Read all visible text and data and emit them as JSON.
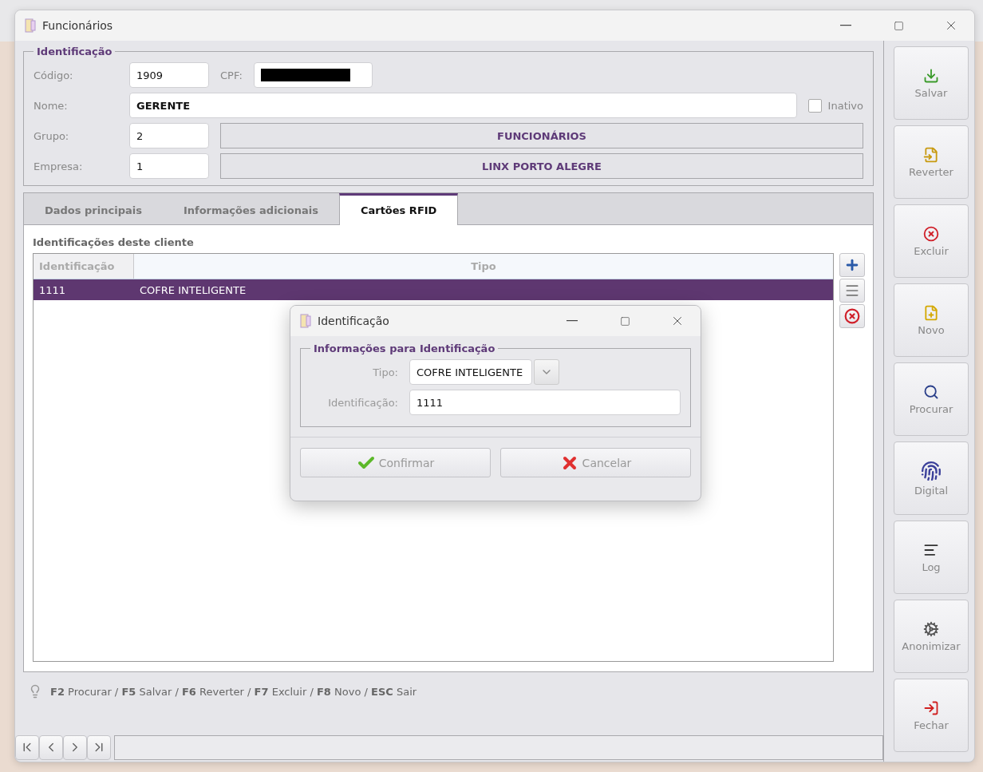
{
  "window": {
    "title": "Funcionários"
  },
  "identificacao": {
    "legend": "Identificação",
    "codigo": {
      "label": "Código:",
      "value": "1909"
    },
    "cpf": {
      "label": "CPF:",
      "redacted": true
    },
    "nome": {
      "label": "Nome:",
      "value": "GERENTE"
    },
    "inativo": {
      "label": "Inativo",
      "checked": false
    },
    "grupo": {
      "label": "Grupo:",
      "value": "2",
      "description": "FUNCIONÁRIOS"
    },
    "empresa": {
      "label": "Empresa:",
      "value": "1",
      "description": "LINX PORTO ALEGRE"
    }
  },
  "tabs": [
    {
      "label": "Dados principais",
      "selected": false
    },
    {
      "label": "Informações adicionais",
      "selected": false
    },
    {
      "label": "Cartões RFID",
      "selected": true
    }
  ],
  "table": {
    "caption": "Identificações deste cliente",
    "columns": [
      "Identificação",
      "Tipo"
    ],
    "rows": [
      {
        "cells": [
          "1111",
          "COFRE INTELIGENTE"
        ],
        "selected": true
      }
    ]
  },
  "table_tools": [
    {
      "kind": "add"
    },
    {
      "kind": "edit"
    },
    {
      "kind": "delete"
    }
  ],
  "hint": "**F2** Procurar / **F5** Salvar / **F6** Reverter / **F7** Excluir / **F8** Novo / **ESC** Sair",
  "sidebar": [
    {
      "label": "Salvar",
      "kind": "save"
    },
    {
      "label": "Reverter",
      "kind": "revert"
    },
    {
      "label": "Excluir",
      "kind": "delete"
    },
    {
      "label": "Novo",
      "kind": "new"
    },
    {
      "label": "Procurar",
      "kind": "search"
    },
    {
      "label": "Digital",
      "kind": "digital"
    },
    {
      "label": "Log",
      "kind": "log"
    },
    {
      "label": "Anonimizar",
      "kind": "anonymize"
    },
    {
      "label": "Fechar",
      "kind": "close"
    }
  ],
  "navigation": [
    {
      "kind": "first"
    },
    {
      "kind": "prev"
    },
    {
      "kind": "next"
    },
    {
      "kind": "last"
    }
  ],
  "dialog": {
    "title": "Identificação",
    "legend": "Informações para Identificação",
    "tipo": {
      "label": "Tipo:",
      "value": "COFRE INTELIGENTE"
    },
    "identificacao": {
      "label": "Identificação:",
      "value": "1111"
    },
    "buttons": [
      {
        "label": "Confirmar",
        "kind": "confirm"
      },
      {
        "label": "Cancelar",
        "kind": "cancel"
      }
    ]
  }
}
